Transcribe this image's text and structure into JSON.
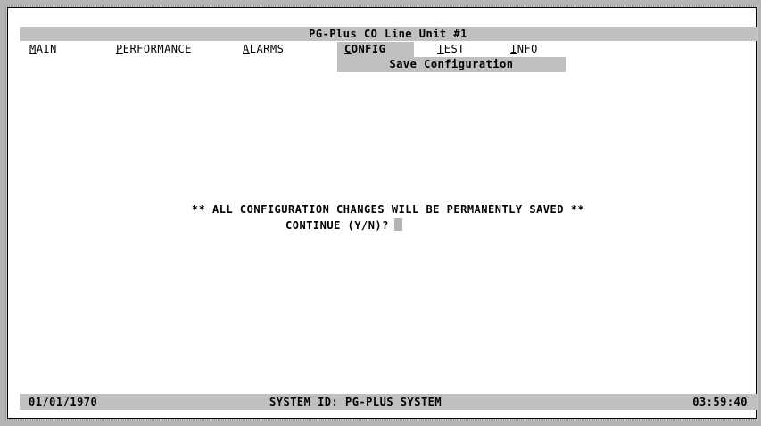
{
  "title": "PG-Plus CO Line Unit #1",
  "menu": {
    "main": {
      "hot": "M",
      "rest": "AIN"
    },
    "performance": {
      "hot": "P",
      "rest": "ERFORMANCE"
    },
    "alarms": {
      "hot": "A",
      "rest": "LARMS"
    },
    "config": {
      "hot": "C",
      "rest": "ONFIG"
    },
    "test": {
      "hot": "T",
      "rest": "EST"
    },
    "info": {
      "hot": "I",
      "rest": "NFO"
    }
  },
  "submenu": {
    "selected": "Save Configuration"
  },
  "message": {
    "warning": "** ALL CONFIGURATION CHANGES WILL BE PERMANENTLY SAVED **",
    "prompt": "CONTINUE (Y/N)?"
  },
  "status": {
    "date": "01/01/1970",
    "system_id": "SYSTEM ID: PG-PLUS SYSTEM",
    "time": "03:59:40"
  },
  "colors": {
    "bar": "#c0c0c0",
    "cursor": "#b4b4b4",
    "background": "#ffffff"
  }
}
